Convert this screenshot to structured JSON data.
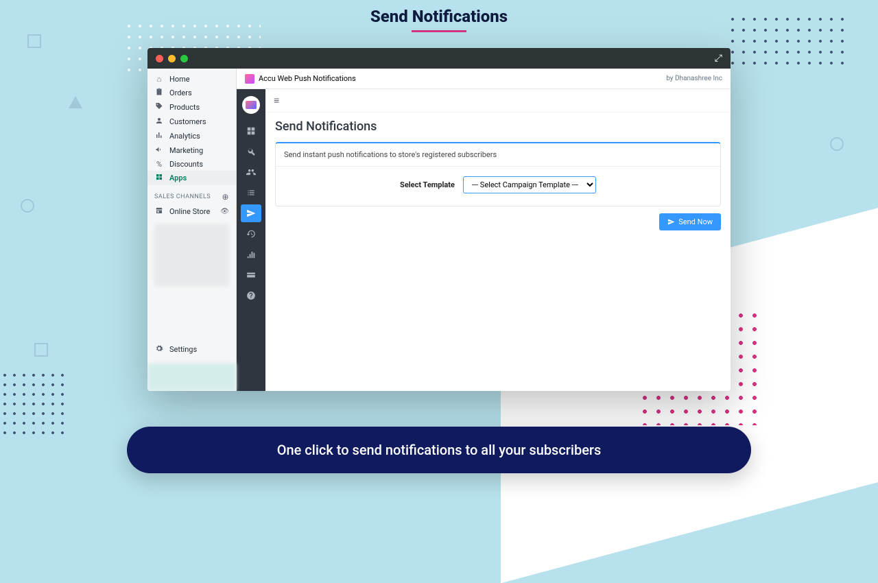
{
  "page_title": "Send Notifications",
  "bottom_pill": "One click to send notifications to all your subscribers",
  "sidebar": {
    "items": [
      {
        "label": "Home"
      },
      {
        "label": "Orders"
      },
      {
        "label": "Products"
      },
      {
        "label": "Customers"
      },
      {
        "label": "Analytics"
      },
      {
        "label": "Marketing"
      },
      {
        "label": "Discounts"
      },
      {
        "label": "Apps"
      }
    ],
    "section_label": "SALES CHANNELS",
    "online_store": "Online Store",
    "settings": "Settings"
  },
  "app_header": {
    "title": "Accu Web Push Notifications",
    "byline": "by Dhanashree Inc"
  },
  "main": {
    "heading": "Send Notifications",
    "description": "Send instant push notifications to store's registered subscribers",
    "select_label": "Select Template",
    "select_placeholder": "--- Select Campaign Template ---",
    "send_button": "Send Now"
  }
}
